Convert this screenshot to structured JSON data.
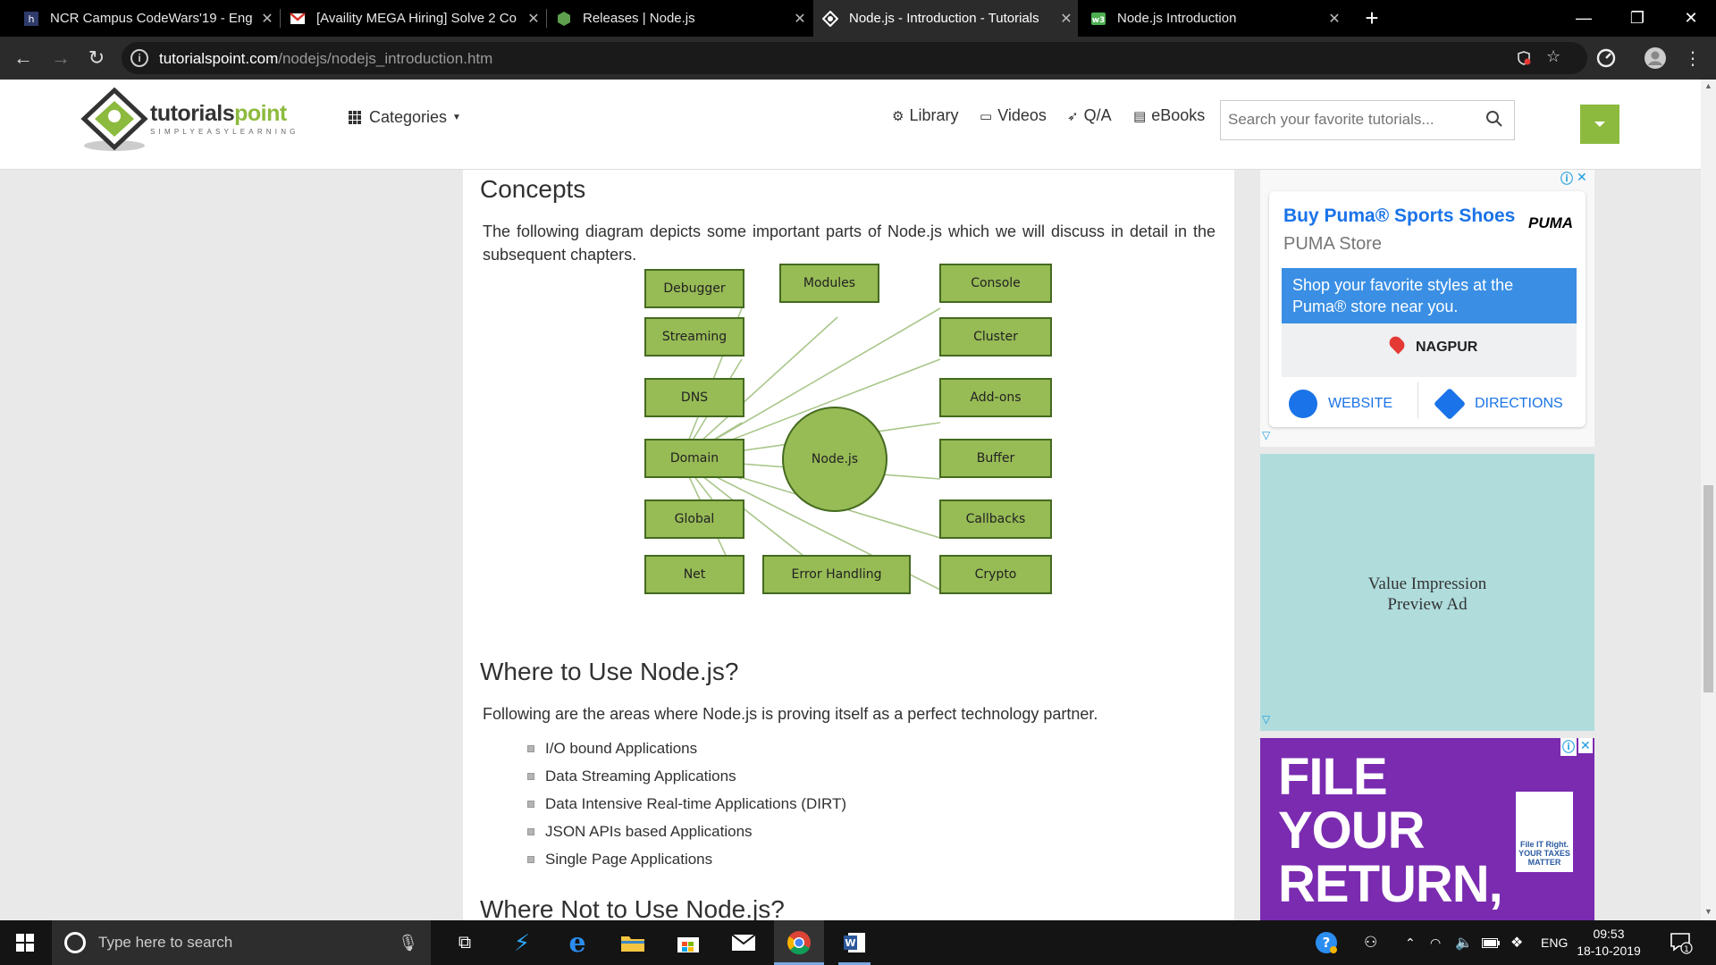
{
  "browser": {
    "tabs": [
      {
        "title": "NCR Campus CodeWars'19 - Eng",
        "active": false,
        "favicon": "hackerearth-icon"
      },
      {
        "title": "[Availity MEGA Hiring] Solve 2 Co",
        "active": false,
        "favicon": "gmail-icon"
      },
      {
        "title": "Releases | Node.js",
        "active": false,
        "favicon": "nodejs-icon"
      },
      {
        "title": "Node.js - Introduction - Tutorials",
        "active": true,
        "favicon": "tutorialspoint-icon"
      },
      {
        "title": "Node.js Introduction",
        "active": false,
        "favicon": "w3schools-icon"
      }
    ],
    "url_domain": "tutorialspoint.com",
    "url_path": "/nodejs/nodejs_introduction.htm"
  },
  "site": {
    "logo_word_1": "tutorials",
    "logo_word_2": "point",
    "logo_tagline": "SIMPLYEASYLEARNING",
    "categories_label": "Categories",
    "nav": {
      "library": "Library",
      "videos": "Videos",
      "qa": "Q/A",
      "ebooks": "eBooks"
    },
    "search_placeholder": "Search your favorite tutorials..."
  },
  "article": {
    "concepts_heading": "Concepts",
    "concepts_para": "The following diagram depicts some important parts of Node.js which we will discuss in detail in the subsequent chapters.",
    "diagram": {
      "center": "Node.js",
      "boxes": [
        "Debugger",
        "Modules",
        "Console",
        "Streaming",
        "Cluster",
        "DNS",
        "Add-ons",
        "Domain",
        "Buffer",
        "Global",
        "Callbacks",
        "Net",
        "Error Handling",
        "Crypto"
      ]
    },
    "where_heading": "Where to Use Node.js?",
    "where_para": "Following are the areas where Node.js is proving itself as a perfect technology partner.",
    "where_list": [
      "I/O bound Applications",
      "Data Streaming Applications",
      "Data Intensive Real-time Applications (DIRT)",
      "JSON APIs based Applications",
      "Single Page Applications"
    ],
    "where_not_heading": "Where Not to Use Node.js?"
  },
  "ads": {
    "puma": {
      "title": "Buy Puma® Sports Shoes",
      "store": "PUMA Store",
      "brand": "PUMA",
      "blurb": "Shop your favorite styles at the Puma® store near you.",
      "city": "NAGPUR",
      "website": "WEBSITE",
      "directions": "DIRECTIONS"
    },
    "preview": {
      "line1": "Value Impression",
      "line2": "Preview Ad"
    },
    "tax": {
      "line1": "FILE",
      "line2": "YOUR",
      "line3": "RETURN,",
      "badge": "File IT Right. YOUR TAXES MATTER"
    }
  },
  "taskbar": {
    "search_placeholder": "Type here to search",
    "language": "ENG",
    "time": "09:53",
    "date": "18-10-2019",
    "notification_count": "1"
  }
}
